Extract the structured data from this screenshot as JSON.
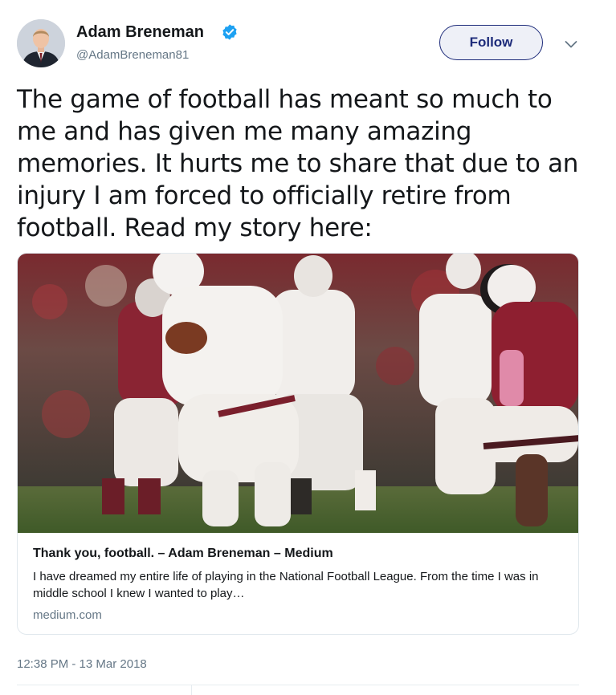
{
  "author": {
    "name": "Adam Breneman",
    "handle": "@AdamBreneman81",
    "verified": true,
    "avatar_icon": "profile-photo"
  },
  "follow_label": "Follow",
  "menu_icon": "chevron-down-icon",
  "tweet_text": "The game of football has meant so much to me and has given me many amazing memories. It hurts me to share that due to an injury I am forced to officially retire from football. Read my story here:",
  "card": {
    "image_icon": "football-game-photo",
    "title": "Thank you, football. – Adam Breneman – Medium",
    "description": "I have dreamed my entire life of playing in the National Football League. From the time I was in middle school I knew I wanted to play…",
    "domain": "medium.com"
  },
  "timestamp": "12:38 PM - 13 Mar 2018",
  "colors": {
    "text": "#14171a",
    "secondary": "#657786",
    "verified": "#1da1f2",
    "follow": "#1d2b7a",
    "border": "#e1e8ed"
  }
}
